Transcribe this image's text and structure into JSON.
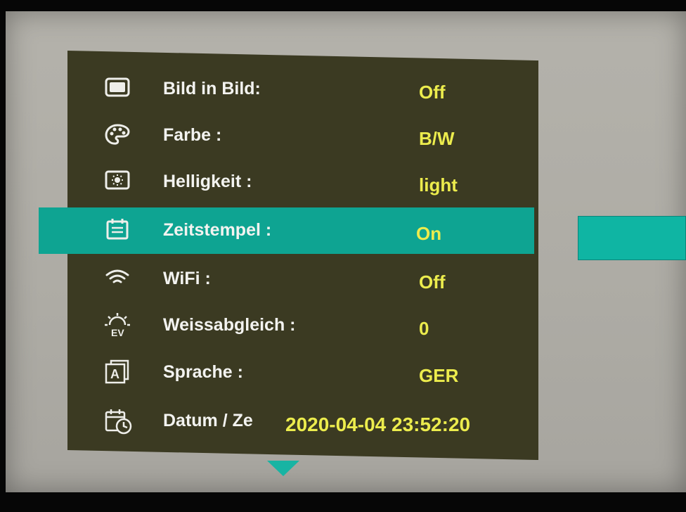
{
  "menu": {
    "items": [
      {
        "label": "Bild in Bild:",
        "value": "Off",
        "icon": "picture-in-picture-icon"
      },
      {
        "label": "Farbe :",
        "value": "B/W",
        "icon": "palette-icon"
      },
      {
        "label": "Helligkeit :",
        "value": "light",
        "icon": "brightness-icon"
      },
      {
        "label": "Zeitstempel :",
        "value": "On",
        "icon": "timestamp-icon",
        "selected": true
      },
      {
        "label": "WiFi :",
        "value": "Off",
        "icon": "wifi-icon"
      },
      {
        "label": "Weissabgleich :",
        "value": "0",
        "icon": "white-balance-ev-icon",
        "icon_text": "EV"
      },
      {
        "label": "Sprache :",
        "value": "GER",
        "icon": "language-icon",
        "icon_text": "A"
      },
      {
        "label": "Datum / Ze",
        "value": "2020-04-04 23:52:20",
        "icon": "date-time-icon"
      }
    ]
  },
  "colors": {
    "menu_background": "#3b3a22",
    "highlight": "#0ea492",
    "value_text": "#ecec4d",
    "label_text": "#f3f3f0",
    "arrow": "#18b4a3"
  },
  "scroll": {
    "icon": "scroll-down-icon"
  }
}
